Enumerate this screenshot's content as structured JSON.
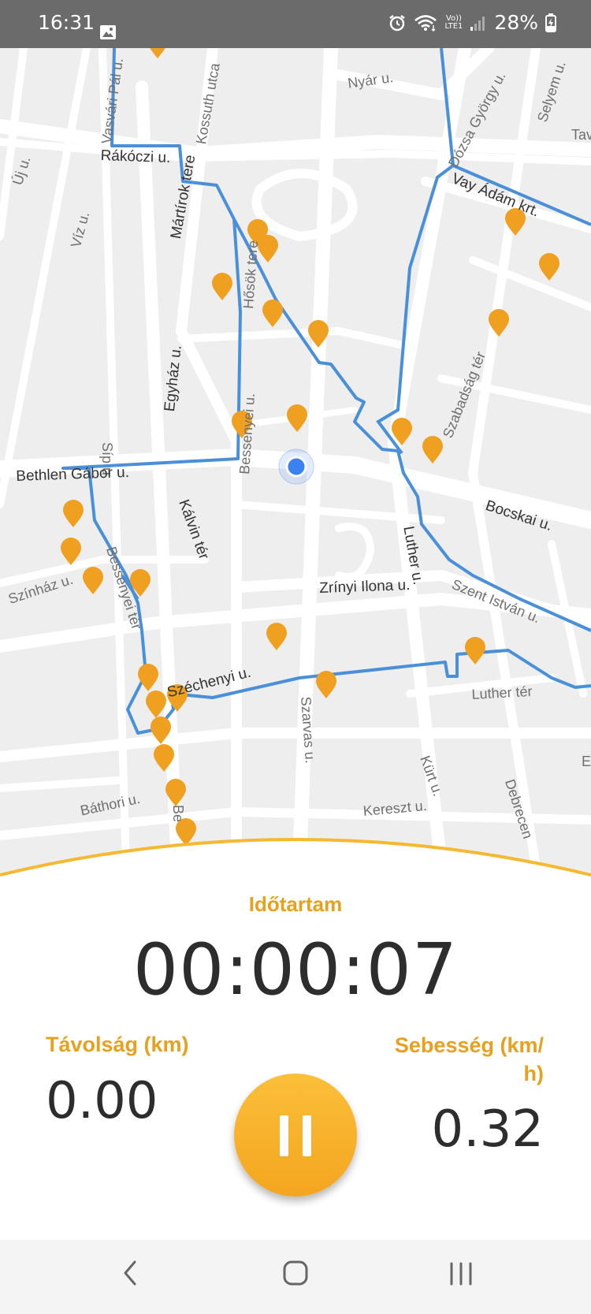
{
  "status_bar": {
    "time": "16:31",
    "battery_percent": "28%",
    "network_top": "Vo))",
    "network_bottom": "LTE1",
    "icons": [
      "image-icon",
      "alarm-icon",
      "wifi-icon",
      "signal-icon",
      "battery-charging-icon"
    ]
  },
  "map": {
    "street_labels": [
      "Vasvári Pál u.",
      "Kossuth utca",
      "Nyár u.",
      "Dózsa György u.",
      "Selyem u.",
      "Tav",
      "Rákóczi u.",
      "Új u.",
      "Vay Ádám krt.",
      "Mártírok tere",
      "Víz u.",
      "Hősök tere",
      "Egyház u.",
      "Szabadság tér",
      "Bessenyei u.",
      "Síp u.",
      "Bethlen Gábor u.",
      "Bocskai u.",
      "Kálvin tér",
      "Luther u.",
      "Színház u.",
      "Bessenyei tér",
      "Zrínyi Ilona u.",
      "Szent István u.",
      "Széchenyi u.",
      "Luther tér",
      "Szarvas u.",
      "Kürt u.",
      "Báthori u.",
      "Kereszt u.",
      "Debrecen",
      "Be",
      "E"
    ],
    "route_color": "#4a90d9",
    "marker_color": "#f0a020",
    "location_color": "#3b82f0"
  },
  "workout": {
    "duration_label": "Időtartam",
    "duration_value": "00:00:07",
    "distance_label": "Távolság (km)",
    "distance_value": "0.00",
    "speed_label_line1": "Sebesség (km/",
    "speed_label_line2": "h)",
    "speed_value": "0.32",
    "pause_icon": "pause-icon",
    "accent_color": "#e8a01f"
  },
  "nav_bar": {
    "icons": [
      "back-icon",
      "home-icon",
      "recents-icon"
    ]
  }
}
